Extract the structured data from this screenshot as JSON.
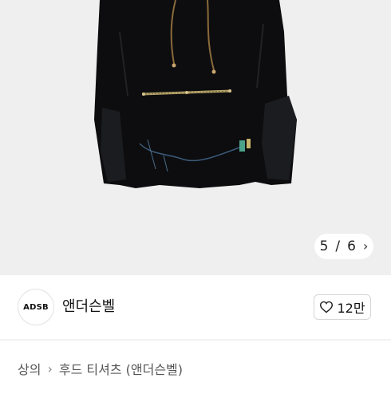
{
  "gallery": {
    "current": "5",
    "separator": "/",
    "total": "6",
    "next_icon": "chevron-right-icon",
    "image": "black-hoodie-product-photo"
  },
  "store": {
    "logo_text": "ADSB",
    "name": "앤더슨벨",
    "like_icon": "heart-outline-icon",
    "like_count": "12만"
  },
  "breadcrumb": {
    "category": "상의",
    "separator_icon": "chevron-right-icon",
    "subcategory": "후드 티셔츠 (앤더슨벨)"
  }
}
